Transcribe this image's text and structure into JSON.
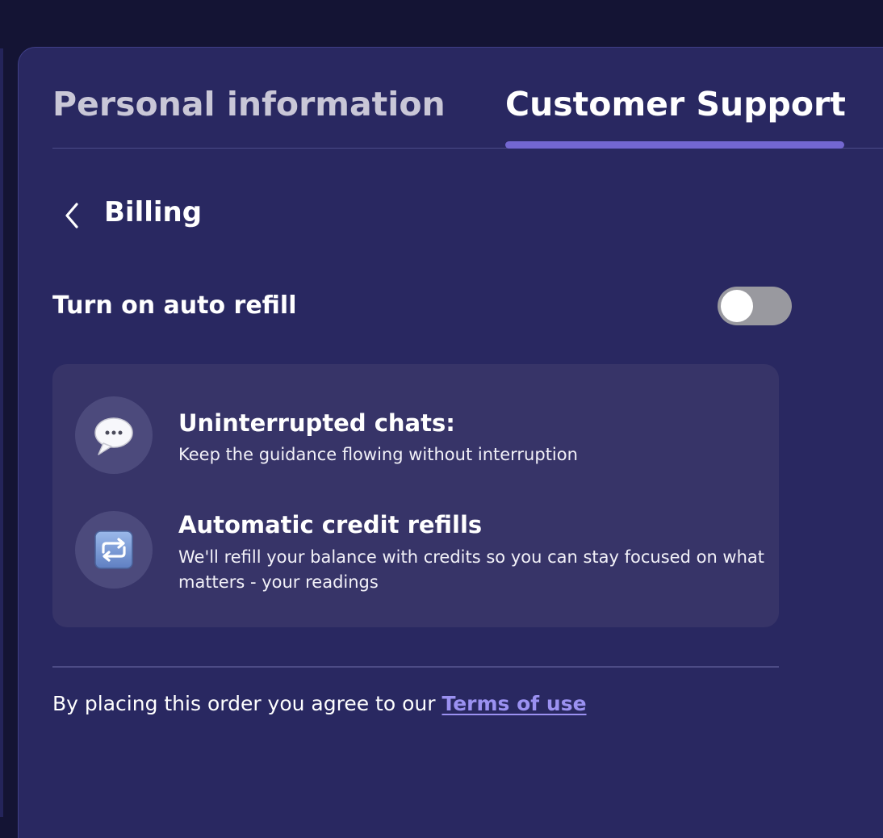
{
  "tabs": {
    "personal_label": "Personal information",
    "support_label": "Customer Support",
    "active": "Customer Support"
  },
  "billing": {
    "title": "Billing",
    "back_icon": "chevron-left-icon"
  },
  "auto_refill": {
    "label": "Turn on auto refill",
    "enabled": false
  },
  "features": [
    {
      "icon": "speech-balloon-icon",
      "title": "Uninterrupted chats:",
      "description": "Keep the guidance flowing without interruption"
    },
    {
      "icon": "repeat-arrows-icon",
      "title": "Automatic credit refills",
      "description": "We'll refill your balance with credits so you can stay focused on what matters - your readings"
    }
  ],
  "terms": {
    "prefix": "By placing this order you agree to our ",
    "link_label": "Terms of use"
  },
  "colors": {
    "background": "#292861",
    "accent": "#7367d1",
    "link": "#9b91f1",
    "card": "#373468"
  }
}
